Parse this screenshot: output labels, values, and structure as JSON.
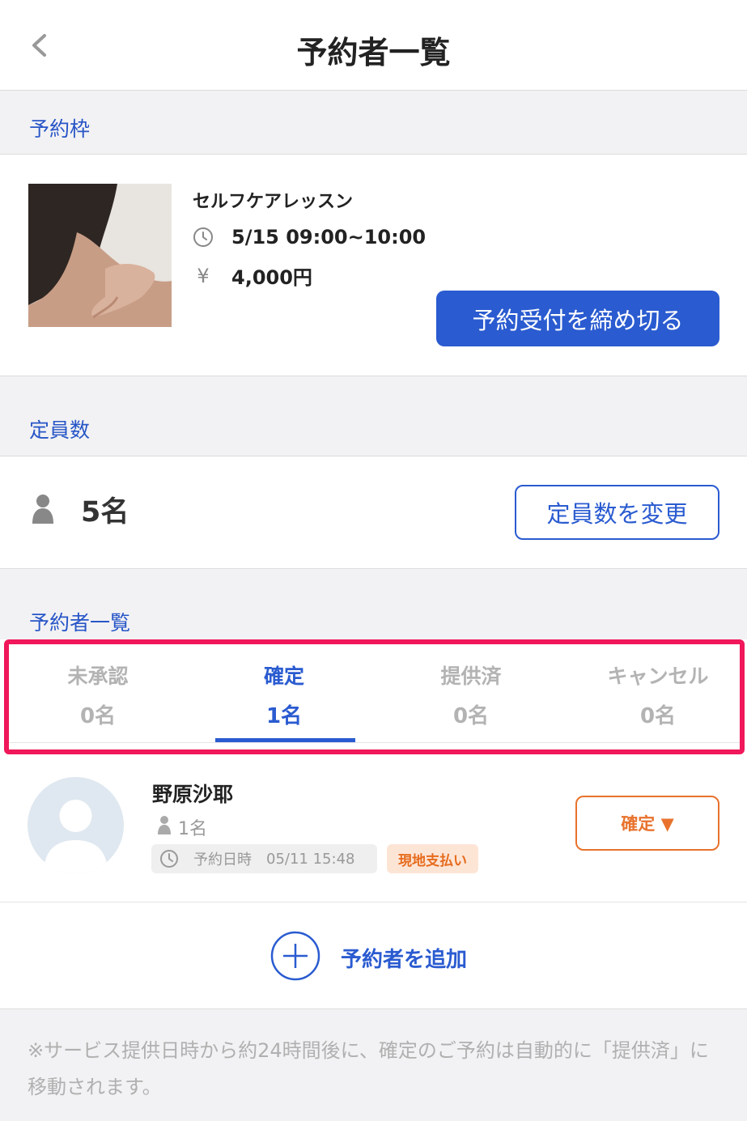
{
  "header": {
    "title": "予約者一覧",
    "back_icon": "chevron-left-icon"
  },
  "slot_section": {
    "label": "予約枠"
  },
  "lesson": {
    "name": "セルフケアレッスン",
    "datetime": "5/15 09:00~10:00",
    "price": "4,000円",
    "price_symbol": "¥",
    "close_button": "予約受付を締め切る"
  },
  "capacity_section": {
    "label": "定員数"
  },
  "capacity": {
    "value": "5名",
    "change_button": "定員数を変更"
  },
  "reservations_section": {
    "label": "予約者一覧"
  },
  "tabs": [
    {
      "label": "未承認",
      "count": "0名",
      "active": false
    },
    {
      "label": "確定",
      "count": "1名",
      "active": true
    },
    {
      "label": "提供済",
      "count": "0名",
      "active": false
    },
    {
      "label": "キャンセル",
      "count": "0名",
      "active": false
    }
  ],
  "reservation": {
    "name": "野原沙耶",
    "party_size": "1名",
    "date_label": "予約日時",
    "date_value": "05/11 15:48",
    "payment_badge": "現地支払い",
    "status_button": "確定 ▼"
  },
  "add": {
    "label": "予約者を追加"
  },
  "note": {
    "text": "※サービス提供日時から約24時間後に、確定のご予約は自動的に「提供済」に移動されます。"
  },
  "colors": {
    "accent": "#2a5bd0",
    "highlight": "#f0175a",
    "status_orange": "#e8722c"
  }
}
